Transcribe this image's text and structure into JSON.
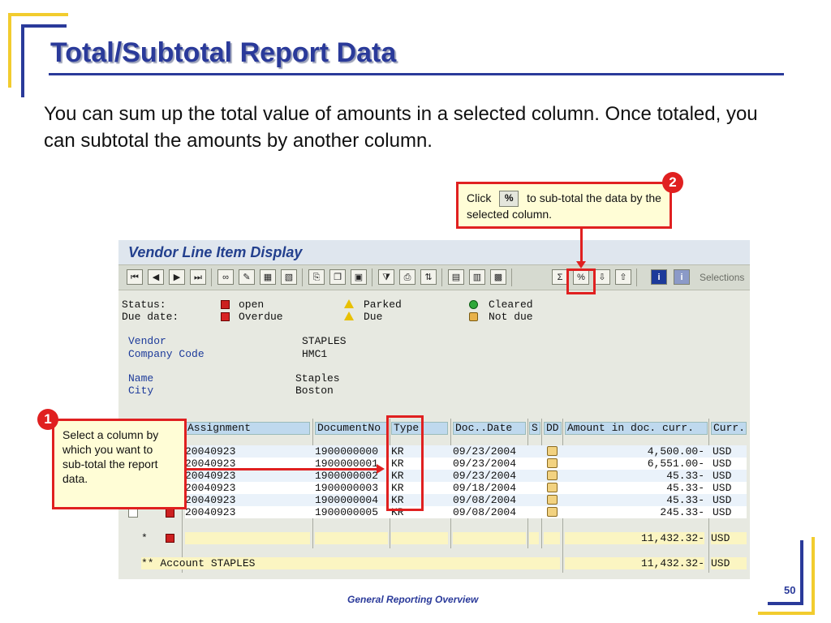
{
  "slide": {
    "title": "Total/Subtotal Report Data",
    "intro": "You can sum up the total value of amounts in a selected column. Once totaled, you can subtotal the amounts by another column.",
    "footer": "General Reporting Overview",
    "page_number": "50"
  },
  "callout_1": {
    "badge": "1",
    "text": "Select a column by which you want to sub-total the report data."
  },
  "callout_2": {
    "badge": "2",
    "text_before": "Click",
    "text_after": "to sub-total the data by the selected column."
  },
  "sap": {
    "window_title": "Vendor Line Item Display",
    "toolbar_selections": "Selections",
    "legend": {
      "status_label": "Status:",
      "due_label": "Due date:",
      "open": "open",
      "parked": "Parked",
      "cleared": "Cleared",
      "overdue": "Overdue",
      "due": "Due",
      "not_due": "Not due"
    },
    "header_fields": {
      "vendor_label": "Vendor",
      "vendor_value": "STAPLES",
      "company_code_label": "Company Code",
      "company_code_value": "HMC1",
      "name_label": "Name",
      "name_value": "Staples",
      "city_label": "City",
      "city_value": "Boston"
    },
    "columns": [
      "Assignment",
      "DocumentNo",
      "Type",
      "Doc..Date",
      "S",
      "DD",
      "Amount in doc. curr.",
      "Curr."
    ],
    "rows": [
      {
        "assignment": "20040923",
        "document_no": "1900000000",
        "type": "KR",
        "doc_date": "09/23/2004",
        "amount": "4,500.00-",
        "curr": "USD"
      },
      {
        "assignment": "20040923",
        "document_no": "1900000001",
        "type": "KR",
        "doc_date": "09/23/2004",
        "amount": "6,551.00-",
        "curr": "USD"
      },
      {
        "assignment": "20040923",
        "document_no": "1900000002",
        "type": "KR",
        "doc_date": "09/23/2004",
        "amount": "45.33-",
        "curr": "USD"
      },
      {
        "assignment": "20040923",
        "document_no": "1900000003",
        "type": "KR",
        "doc_date": "09/18/2004",
        "amount": "45.33-",
        "curr": "USD"
      },
      {
        "assignment": "20040923",
        "document_no": "1900000004",
        "type": "KR",
        "doc_date": "09/08/2004",
        "amount": "45.33-",
        "curr": "USD"
      },
      {
        "assignment": "20040923",
        "document_no": "1900000005",
        "type": "KR",
        "doc_date": "09/08/2004",
        "amount": "245.33-",
        "curr": "USD"
      }
    ],
    "total_row": {
      "marker": "*",
      "amount": "11,432.32-",
      "curr": "USD"
    },
    "account_row": {
      "label": "** Account STAPLES",
      "amount": "11,432.32-",
      "curr": "USD"
    }
  },
  "colors": {
    "title_blue": "#2a3a9a",
    "accent_yellow": "#f2cc2e",
    "callout_red": "#e02020",
    "callout_fill": "#fffdd6",
    "grid_header": "#bfd9ee"
  }
}
